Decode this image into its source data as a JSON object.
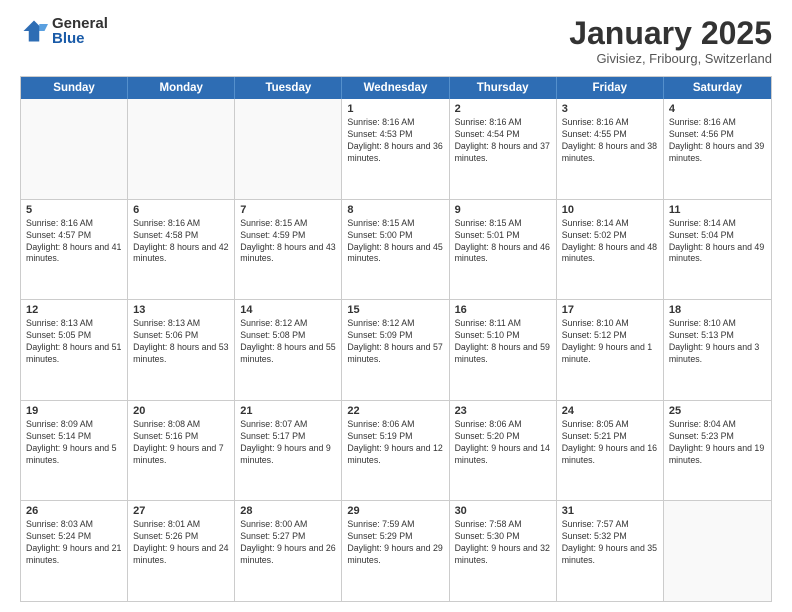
{
  "logo": {
    "general": "General",
    "blue": "Blue"
  },
  "title": "January 2025",
  "location": "Givisiez, Fribourg, Switzerland",
  "header_days": [
    "Sunday",
    "Monday",
    "Tuesday",
    "Wednesday",
    "Thursday",
    "Friday",
    "Saturday"
  ],
  "weeks": [
    [
      {
        "day": "",
        "text": ""
      },
      {
        "day": "",
        "text": ""
      },
      {
        "day": "",
        "text": ""
      },
      {
        "day": "1",
        "text": "Sunrise: 8:16 AM\nSunset: 4:53 PM\nDaylight: 8 hours and 36 minutes."
      },
      {
        "day": "2",
        "text": "Sunrise: 8:16 AM\nSunset: 4:54 PM\nDaylight: 8 hours and 37 minutes."
      },
      {
        "day": "3",
        "text": "Sunrise: 8:16 AM\nSunset: 4:55 PM\nDaylight: 8 hours and 38 minutes."
      },
      {
        "day": "4",
        "text": "Sunrise: 8:16 AM\nSunset: 4:56 PM\nDaylight: 8 hours and 39 minutes."
      }
    ],
    [
      {
        "day": "5",
        "text": "Sunrise: 8:16 AM\nSunset: 4:57 PM\nDaylight: 8 hours and 41 minutes."
      },
      {
        "day": "6",
        "text": "Sunrise: 8:16 AM\nSunset: 4:58 PM\nDaylight: 8 hours and 42 minutes."
      },
      {
        "day": "7",
        "text": "Sunrise: 8:15 AM\nSunset: 4:59 PM\nDaylight: 8 hours and 43 minutes."
      },
      {
        "day": "8",
        "text": "Sunrise: 8:15 AM\nSunset: 5:00 PM\nDaylight: 8 hours and 45 minutes."
      },
      {
        "day": "9",
        "text": "Sunrise: 8:15 AM\nSunset: 5:01 PM\nDaylight: 8 hours and 46 minutes."
      },
      {
        "day": "10",
        "text": "Sunrise: 8:14 AM\nSunset: 5:02 PM\nDaylight: 8 hours and 48 minutes."
      },
      {
        "day": "11",
        "text": "Sunrise: 8:14 AM\nSunset: 5:04 PM\nDaylight: 8 hours and 49 minutes."
      }
    ],
    [
      {
        "day": "12",
        "text": "Sunrise: 8:13 AM\nSunset: 5:05 PM\nDaylight: 8 hours and 51 minutes."
      },
      {
        "day": "13",
        "text": "Sunrise: 8:13 AM\nSunset: 5:06 PM\nDaylight: 8 hours and 53 minutes."
      },
      {
        "day": "14",
        "text": "Sunrise: 8:12 AM\nSunset: 5:08 PM\nDaylight: 8 hours and 55 minutes."
      },
      {
        "day": "15",
        "text": "Sunrise: 8:12 AM\nSunset: 5:09 PM\nDaylight: 8 hours and 57 minutes."
      },
      {
        "day": "16",
        "text": "Sunrise: 8:11 AM\nSunset: 5:10 PM\nDaylight: 8 hours and 59 minutes."
      },
      {
        "day": "17",
        "text": "Sunrise: 8:10 AM\nSunset: 5:12 PM\nDaylight: 9 hours and 1 minute."
      },
      {
        "day": "18",
        "text": "Sunrise: 8:10 AM\nSunset: 5:13 PM\nDaylight: 9 hours and 3 minutes."
      }
    ],
    [
      {
        "day": "19",
        "text": "Sunrise: 8:09 AM\nSunset: 5:14 PM\nDaylight: 9 hours and 5 minutes."
      },
      {
        "day": "20",
        "text": "Sunrise: 8:08 AM\nSunset: 5:16 PM\nDaylight: 9 hours and 7 minutes."
      },
      {
        "day": "21",
        "text": "Sunrise: 8:07 AM\nSunset: 5:17 PM\nDaylight: 9 hours and 9 minutes."
      },
      {
        "day": "22",
        "text": "Sunrise: 8:06 AM\nSunset: 5:19 PM\nDaylight: 9 hours and 12 minutes."
      },
      {
        "day": "23",
        "text": "Sunrise: 8:06 AM\nSunset: 5:20 PM\nDaylight: 9 hours and 14 minutes."
      },
      {
        "day": "24",
        "text": "Sunrise: 8:05 AM\nSunset: 5:21 PM\nDaylight: 9 hours and 16 minutes."
      },
      {
        "day": "25",
        "text": "Sunrise: 8:04 AM\nSunset: 5:23 PM\nDaylight: 9 hours and 19 minutes."
      }
    ],
    [
      {
        "day": "26",
        "text": "Sunrise: 8:03 AM\nSunset: 5:24 PM\nDaylight: 9 hours and 21 minutes."
      },
      {
        "day": "27",
        "text": "Sunrise: 8:01 AM\nSunset: 5:26 PM\nDaylight: 9 hours and 24 minutes."
      },
      {
        "day": "28",
        "text": "Sunrise: 8:00 AM\nSunset: 5:27 PM\nDaylight: 9 hours and 26 minutes."
      },
      {
        "day": "29",
        "text": "Sunrise: 7:59 AM\nSunset: 5:29 PM\nDaylight: 9 hours and 29 minutes."
      },
      {
        "day": "30",
        "text": "Sunrise: 7:58 AM\nSunset: 5:30 PM\nDaylight: 9 hours and 32 minutes."
      },
      {
        "day": "31",
        "text": "Sunrise: 7:57 AM\nSunset: 5:32 PM\nDaylight: 9 hours and 35 minutes."
      },
      {
        "day": "",
        "text": ""
      }
    ]
  ]
}
